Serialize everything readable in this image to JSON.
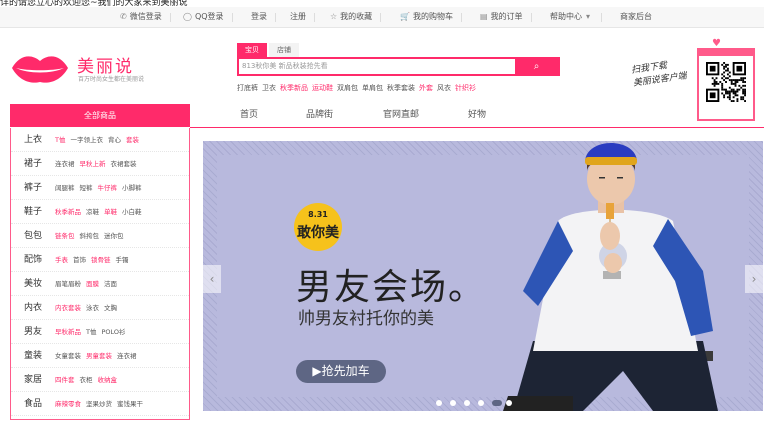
{
  "notice": "详的请您立心的欢迎您~我们的大家来到美丽说",
  "topbar": {
    "wechat_login": "微信登录",
    "qq_login": "QQ登录",
    "login": "登录",
    "register": "注册",
    "favorites": "我的收藏",
    "cart": "我的购物车",
    "orders": "我的订单",
    "help": "帮助中心",
    "merchant": "商家后台"
  },
  "logo": {
    "brand": "美丽说",
    "slogan": "百万时尚女生都在美丽说"
  },
  "search": {
    "tabs": [
      "宝贝",
      "店铺"
    ],
    "placeholder": "813秋你美 新品秋装抢先看",
    "button": "⌕",
    "hot": [
      {
        "text": "打底裤",
        "hot": false
      },
      {
        "text": "卫衣",
        "hot": false
      },
      {
        "text": "秋季新品",
        "hot": true
      },
      {
        "text": "运动鞋",
        "hot": true
      },
      {
        "text": "双肩包",
        "hot": false
      },
      {
        "text": "单肩包",
        "hot": false
      },
      {
        "text": "秋季套装",
        "hot": false
      },
      {
        "text": "外套",
        "hot": true
      },
      {
        "text": "风衣",
        "hot": false
      },
      {
        "text": "针织衫",
        "hot": true
      }
    ]
  },
  "promo": {
    "line1": "扫我下载",
    "line2": "美丽说客户端"
  },
  "nav": {
    "category_header": "全部商品",
    "items": [
      "首页",
      "品牌街",
      "官网直邮",
      "好物"
    ]
  },
  "categories": [
    {
      "name": "上衣",
      "subs": [
        {
          "t": "T恤",
          "h": true
        },
        {
          "t": "一字领上衣",
          "h": false
        },
        {
          "t": "背心",
          "h": false
        },
        {
          "t": "套装",
          "h": true
        }
      ]
    },
    {
      "name": "裙子",
      "subs": [
        {
          "t": "连衣裙",
          "h": false
        },
        {
          "t": "早秋上新",
          "h": true
        },
        {
          "t": "衣裙套装",
          "h": false
        }
      ]
    },
    {
      "name": "裤子",
      "subs": [
        {
          "t": "阔腿裤",
          "h": false
        },
        {
          "t": "短裤",
          "h": false
        },
        {
          "t": "牛仔裤",
          "h": true
        },
        {
          "t": "小脚裤",
          "h": false
        }
      ]
    },
    {
      "name": "鞋子",
      "subs": [
        {
          "t": "秋季新品",
          "h": true
        },
        {
          "t": "凉鞋",
          "h": false
        },
        {
          "t": "单鞋",
          "h": true
        },
        {
          "t": "小白鞋",
          "h": false
        }
      ]
    },
    {
      "name": "包包",
      "subs": [
        {
          "t": "链条包",
          "h": true
        },
        {
          "t": "斜挎包",
          "h": false
        },
        {
          "t": "迷你包",
          "h": false
        }
      ]
    },
    {
      "name": "配饰",
      "subs": [
        {
          "t": "手表",
          "h": true
        },
        {
          "t": "首饰",
          "h": false
        },
        {
          "t": "锁骨链",
          "h": true
        },
        {
          "t": "手镯",
          "h": false
        }
      ]
    },
    {
      "name": "美妆",
      "subs": [
        {
          "t": "眉笔眉粉",
          "h": false
        },
        {
          "t": "面膜",
          "h": true
        },
        {
          "t": "洁面",
          "h": false
        }
      ]
    },
    {
      "name": "内衣",
      "subs": [
        {
          "t": "内衣套装",
          "h": true
        },
        {
          "t": "泳衣",
          "h": false
        },
        {
          "t": "文胸",
          "h": false
        }
      ]
    },
    {
      "name": "男友",
      "subs": [
        {
          "t": "早秋新品",
          "h": true
        },
        {
          "t": "T恤",
          "h": false
        },
        {
          "t": "POLO衫",
          "h": false
        }
      ]
    },
    {
      "name": "童装",
      "subs": [
        {
          "t": "女童套装",
          "h": false
        },
        {
          "t": "男童套装",
          "h": true
        },
        {
          "t": "连衣裙",
          "h": false
        }
      ]
    },
    {
      "name": "家居",
      "subs": [
        {
          "t": "四件套",
          "h": true
        },
        {
          "t": "衣柜",
          "h": false
        },
        {
          "t": "收纳盒",
          "h": true
        }
      ]
    },
    {
      "name": "食品",
      "subs": [
        {
          "t": "麻辣零食",
          "h": true
        },
        {
          "t": "坚果炒货",
          "h": false
        },
        {
          "t": "蜜饯果干",
          "h": false
        }
      ]
    }
  ],
  "banner": {
    "badge_date": "8.31",
    "badge_text": "敢你美",
    "title": "男友会场。",
    "subtitle": "帅男友衬托你的美",
    "cta": "▶抢先加车",
    "slide_count": 6,
    "active_slide": 5
  },
  "colors": {
    "accent": "#ff2a6a",
    "banner_bg": "#b8b9dd",
    "cta": "#5e6684"
  }
}
